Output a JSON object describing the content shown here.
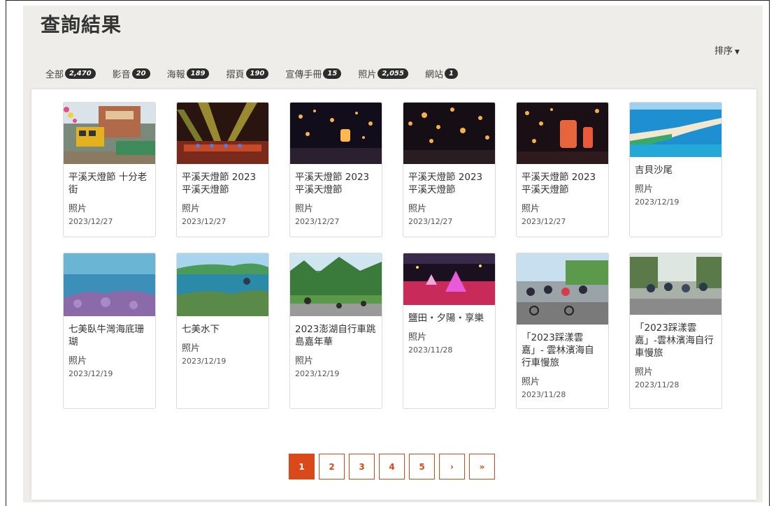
{
  "page_title": "查詢結果",
  "sort_label": "排序",
  "tabs": [
    {
      "label": "全部",
      "count": "2,470"
    },
    {
      "label": "影音",
      "count": "20"
    },
    {
      "label": "海報",
      "count": "189"
    },
    {
      "label": "摺頁",
      "count": "190"
    },
    {
      "label": "宣傳手冊",
      "count": "15"
    },
    {
      "label": "照片",
      "count": "2,055"
    },
    {
      "label": "網站",
      "count": "1"
    }
  ],
  "cards": [
    {
      "title": "平溪天燈節 十分老街",
      "type": "照片",
      "date": "2023/12/27"
    },
    {
      "title": "平溪天燈節 2023 平溪天燈節",
      "type": "照片",
      "date": "2023/12/27"
    },
    {
      "title": "平溪天燈節 2023 平溪天燈節",
      "type": "照片",
      "date": "2023/12/27"
    },
    {
      "title": "平溪天燈節 2023 平溪天燈節",
      "type": "照片",
      "date": "2023/12/27"
    },
    {
      "title": "平溪天燈節 2023 平溪天燈節",
      "type": "照片",
      "date": "2023/12/27"
    },
    {
      "title": "吉貝沙尾",
      "type": "照片",
      "date": "2023/12/19"
    },
    {
      "title": "七美臥牛灣海底珊瑚",
      "type": "照片",
      "date": "2023/12/19"
    },
    {
      "title": "七美水下",
      "type": "照片",
      "date": "2023/12/19"
    },
    {
      "title": "2023澎湖自行車跳島嘉年華",
      "type": "照片",
      "date": "2023/12/19"
    },
    {
      "title": "鹽田・夕陽・享樂",
      "type": "照片",
      "date": "2023/11/28"
    },
    {
      "title": "「2023踩漾雲嘉」- 雲林濱海自行車慢旅",
      "type": "照片",
      "date": "2023/11/28"
    },
    {
      "title": "「2023踩漾雲嘉」-雲林濱海自行車慢旅",
      "type": "照片",
      "date": "2023/11/28"
    }
  ],
  "pagination": {
    "pages": [
      "1",
      "2",
      "3",
      "4",
      "5"
    ],
    "current": "1",
    "next": "›",
    "last": "»"
  },
  "colors": {
    "accent": "#d9491a",
    "panel_bg": "#eeede9",
    "badge_bg": "#2c2c2c"
  }
}
